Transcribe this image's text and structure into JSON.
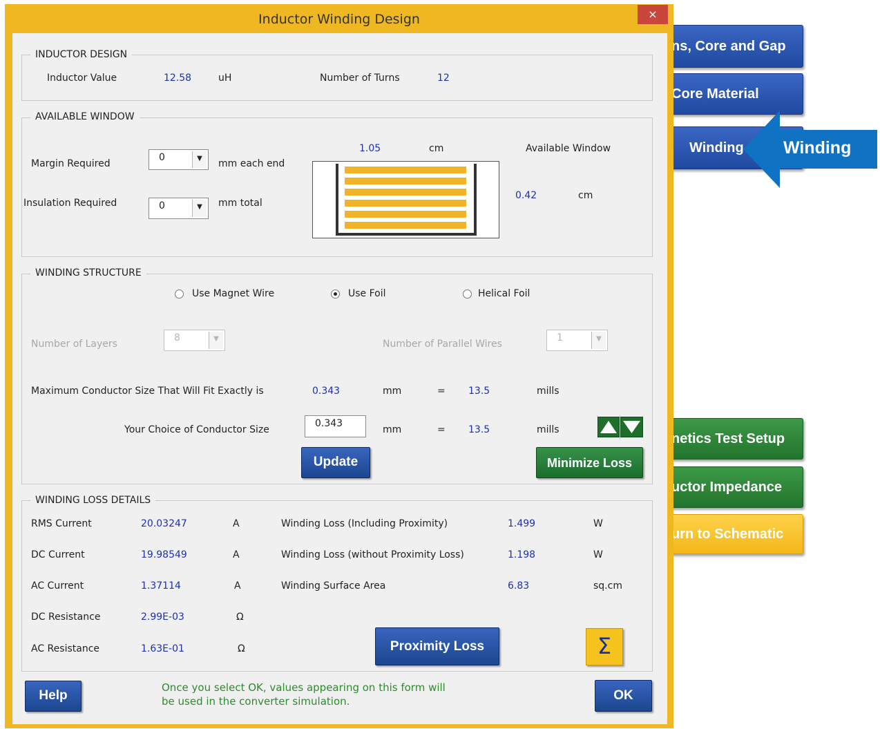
{
  "background_buttons": {
    "core_gap": "ns, Core and Gap",
    "core_material": "Core Material",
    "winding": "Winding",
    "magnetics_test": "netics Test Setup",
    "inductor_impedance": "uctor Impedance",
    "return_schematic": "urn to Schematic"
  },
  "callout": {
    "label": "Winding",
    "color": "#0f72c2"
  },
  "dialog": {
    "title": "Inductor Winding Design",
    "close_glyph": "×"
  },
  "inductor_design": {
    "legend": "INDUCTOR DESIGN",
    "inductor_value_label": "Inductor Value",
    "inductor_value": "12.58",
    "inductor_unit": "uH",
    "turns_label": "Number of Turns",
    "turns_value": "12"
  },
  "available_window": {
    "legend": "AVAILABLE WINDOW",
    "margin_label": "Margin Required",
    "margin_value": "0",
    "margin_unit": "mm each end",
    "insulation_label": "Insulation Required",
    "insulation_value": "0",
    "insulation_unit": "mm total",
    "width_value": "1.05",
    "width_unit": "cm",
    "window_label": "Available Window",
    "height_value": "0.42",
    "height_unit": "cm"
  },
  "winding_structure": {
    "legend": "WINDING STRUCTURE",
    "opt_magnet_wire": "Use Magnet Wire",
    "opt_foil": "Use Foil",
    "opt_helical": "Helical Foil",
    "selected": "Use Foil",
    "layers_label": "Number of Layers",
    "layers_value": "8",
    "parallel_label": "Number of Parallel Wires",
    "parallel_value": "1",
    "max_label": "Maximum Conductor Size That Will Fit Exactly is",
    "max_mm": "0.343",
    "mm_unit": "mm",
    "equals": "=",
    "max_mills": "13.5",
    "mills_unit": "mills",
    "choice_label": "Your Choice of Conductor Size",
    "choice_mm": "0.343",
    "choice_mills": "13.5",
    "update_label": "Update",
    "minimize_label": "Minimize Loss"
  },
  "loss_details": {
    "legend": "WINDING LOSS DETAILS",
    "rows": [
      {
        "label": "RMS Current",
        "value": "20.03247",
        "unit": "A"
      },
      {
        "label": "DC Current",
        "value": "19.98549",
        "unit": "A"
      },
      {
        "label": "AC  Current",
        "value": "1.37114",
        "unit": "A"
      },
      {
        "label": "DC Resistance",
        "value": "2.99E-03",
        "unit": "Ω"
      },
      {
        "label": "AC Resistance",
        "value": "1.63E-01",
        "unit": "Ω"
      }
    ],
    "right": [
      {
        "label": "Winding Loss (Including Proximity)",
        "value": "1.499",
        "unit": "W"
      },
      {
        "label": "Winding Loss (without Proximity Loss)",
        "value": "1.198",
        "unit": "W"
      },
      {
        "label": "Winding Surface Area",
        "value": "6.83",
        "unit": "sq.cm"
      }
    ],
    "proximity_label": "Proximity Loss",
    "sigma_glyph": "Σ"
  },
  "footer": {
    "help_label": "Help",
    "ok_label": "OK",
    "note_line1": "Once you select OK, values appearing on this form will",
    "note_line2": "be used in the converter simulation."
  }
}
